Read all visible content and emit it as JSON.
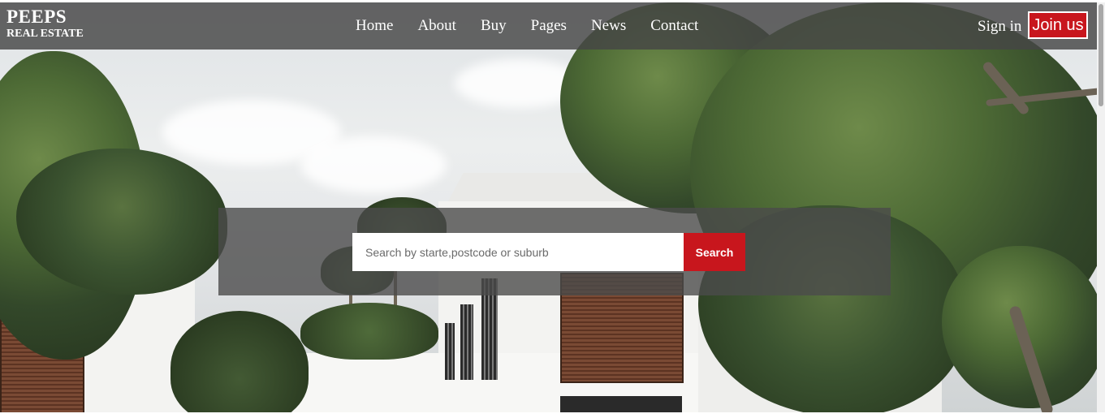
{
  "brand": {
    "name": "PEEPS",
    "subtitle": "REAL ESTATE"
  },
  "nav": {
    "links": [
      "Home",
      "About",
      "Buy",
      "Pages",
      "News",
      "Contact"
    ],
    "sign_in": "Sign in",
    "join": "Join us"
  },
  "search": {
    "placeholder": "Search by starte,postcode or suburb",
    "value": "",
    "button_label": "Search"
  },
  "colors": {
    "accent": "#c8161d",
    "navbar": "#464646",
    "panel": "#4b4b4b"
  },
  "hero": {
    "image": "modern white house with trees and palms"
  }
}
